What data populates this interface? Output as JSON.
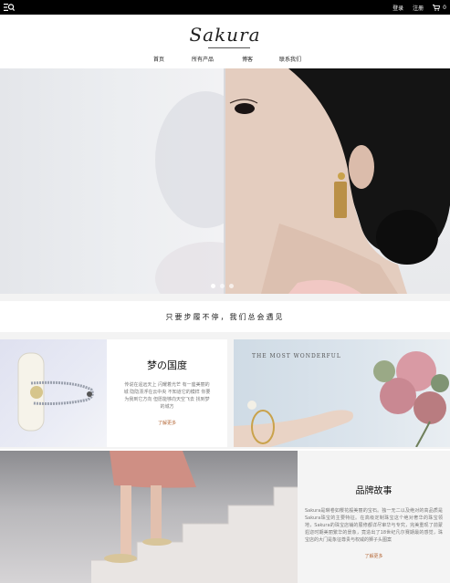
{
  "topbar": {
    "menu_icon": "menu-search-icon",
    "login": "登录",
    "register": "注册",
    "cart_icon": "cart-icon",
    "cart_count": "0"
  },
  "header": {
    "logo": "Sakura",
    "nav": [
      "首页",
      "所有产品",
      "博客",
      "联系我们"
    ]
  },
  "hero": {
    "slide_count": 3,
    "active_slide": 0
  },
  "slogan": "只要步履不停，我们总会遇见",
  "tiles": {
    "dream": {
      "title": "梦の国度",
      "desc": "传说在遥远天上 闪耀着光芒 有一座美丽的城 隐隐漂浮在云中央 不知道它的模样 你要为我到它方向 但愿能够向天空飞去 找到梦的城方",
      "more": "了解更多"
    },
    "wonderful": {
      "caption": "THE MOST WONDERFUL"
    },
    "brand": {
      "title": "品牌故事",
      "desc": "Sakura是琳卷如樱花般美丽的宝石。独一无二以及绝对的高品质是Sakura珠宝的主要特征。在高级定制珠宝这个绝对奢华的珠宝领地，Sakura的珠宝店铺的展修都详尽审华与专究，完美重现了前蒙遐迩时期美丽繁华的景象，竟造出了18世纪凡尔赛期最的感觉，珠宝店的大门是象征尊贵与权威的狮子头图案",
      "more": "了解更多"
    }
  },
  "colors": {
    "topbar": "#000000",
    "accent_link": "#b56a3a",
    "band": "#f3f3f3"
  }
}
